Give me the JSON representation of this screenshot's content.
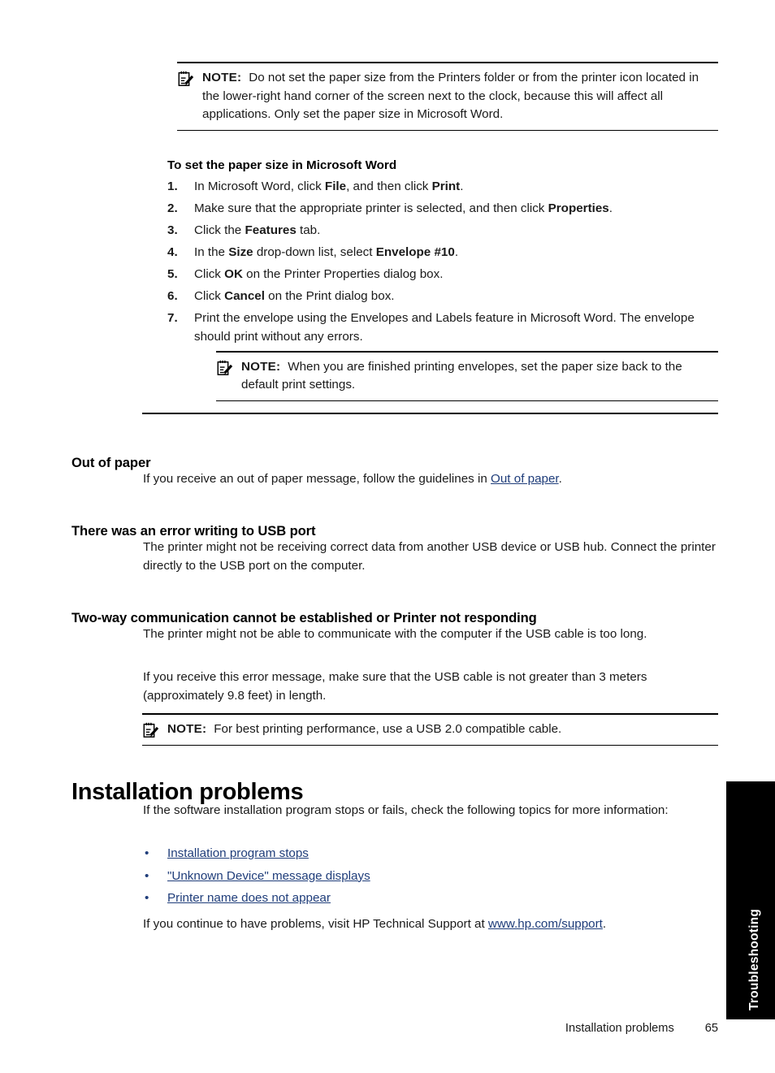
{
  "page": {
    "number": "65",
    "footer_title": "Installation problems",
    "side_tab_label": "Troubleshooting"
  },
  "note_top": {
    "label": "NOTE:",
    "icon": "note-clipboard-pencil-icon",
    "text": "Do not set the paper size from the Printers folder or from the printer icon located in the lower-right hand corner of the screen next to the clock, because this will affect all applications. Only set the paper size in Microsoft Word."
  },
  "procedure": {
    "title": "To set the paper size in Microsoft Word",
    "steps": [
      {
        "num": "1.",
        "html": "In Microsoft Word, click <b>File</b>, and then click <b>Print</b>."
      },
      {
        "num": "2.",
        "html": "Make sure that the appropriate printer is selected, and then click <b>Properties</b>."
      },
      {
        "num": "3.",
        "html": "Click the <b>Features</b> tab."
      },
      {
        "num": "4.",
        "html": "In the <b>Size</b> drop-down list, select <b>Envelope #10</b>."
      },
      {
        "num": "5.",
        "html": "Click <b>OK</b> on the Printer Properties dialog box."
      },
      {
        "num": "6.",
        "html": "Click <b>Cancel</b> on the Print dialog box."
      },
      {
        "num": "7.",
        "html": "Print the envelope using the Envelopes and Labels feature in Microsoft Word. The envelope should print without any errors."
      }
    ]
  },
  "note_nested": {
    "label": "NOTE:",
    "icon": "note-clipboard-pencil-icon",
    "text": "When you are finished printing envelopes, set the paper size back to the default print settings."
  },
  "section_out_of_paper": {
    "heading": "Out of paper",
    "paragraph_html": "If you receive an out of paper message, follow the guidelines in <a class=\"doclink\" data-name=\"link-out-of-paper\" data-interactable=\"true\">Out of paper</a>."
  },
  "section_usb_error": {
    "heading": "There was an error writing to USB port",
    "paragraph": "The printer might not be receiving correct data from another USB device or USB hub. Connect the printer directly to the USB port on the computer."
  },
  "section_two_way": {
    "heading": "Two-way communication cannot be established or Printer not responding",
    "paragraph_1": "The printer might not be able to communicate with the computer if the USB cable is too long.",
    "paragraph_2": "If you receive this error message, make sure that the USB cable is not greater than 3 meters (approximately 9.8 feet) in length."
  },
  "note_usb": {
    "label": "NOTE:",
    "icon": "note-clipboard-pencil-icon",
    "text": "For best printing performance, use a USB 2.0 compatible cable."
  },
  "section_installation": {
    "heading": "Installation problems",
    "intro": "If the software installation program stops or fails, check the following topics for more information:",
    "bullet_char": "•",
    "topics": [
      "Installation program stops",
      "\"Unknown Device\" message displays",
      "Printer name does not appear"
    ],
    "closing_html": "If you continue to have problems, visit HP Technical Support at <a class=\"doclink\" data-name=\"link-hp-support\" data-interactable=\"true\">www.hp.com/support</a>."
  },
  "colors": {
    "link": "#1F3D7A",
    "text": "#1a1a1a",
    "rule": "#000000",
    "tab_background": "#000000",
    "tab_text": "#ffffff"
  }
}
